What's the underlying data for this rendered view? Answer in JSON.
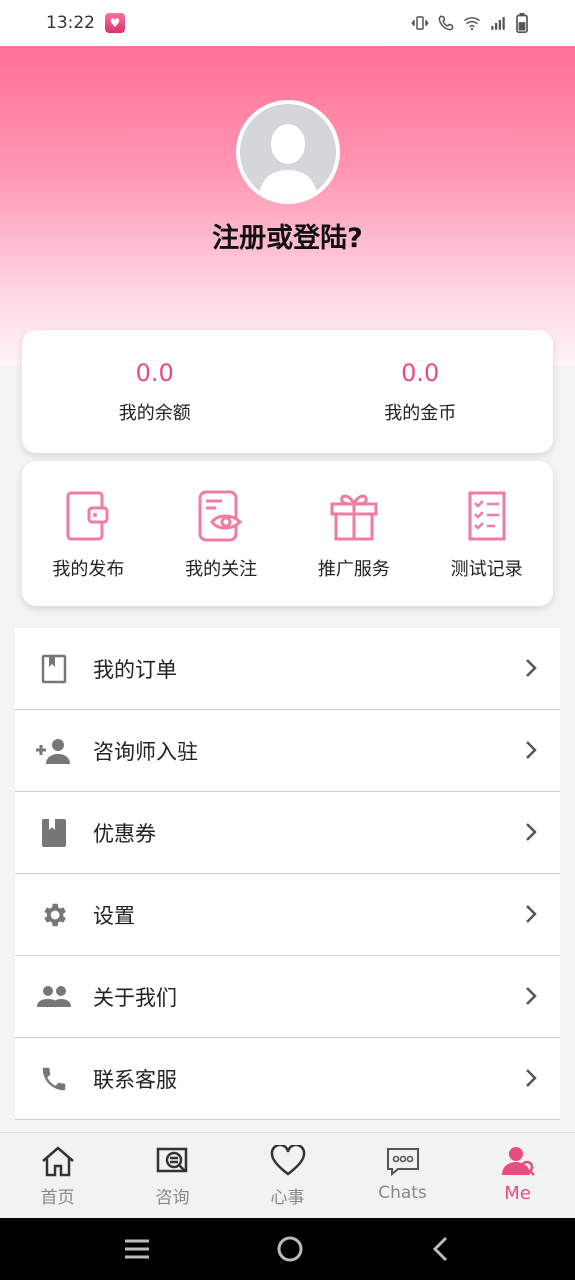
{
  "status_bar": {
    "time": "13:22"
  },
  "header": {
    "login_prompt": "注册或登陆?"
  },
  "balance": [
    {
      "value": "0.0",
      "label": "我的余额"
    },
    {
      "value": "0.0",
      "label": "我的金币"
    }
  ],
  "actions": [
    {
      "label": "我的发布",
      "icon": "wallet-icon"
    },
    {
      "label": "我的关注",
      "icon": "eye-card-icon"
    },
    {
      "label": "推广服务",
      "icon": "gift-icon"
    },
    {
      "label": "测试记录",
      "icon": "checklist-icon"
    }
  ],
  "menu": [
    {
      "label": "我的订单",
      "icon": "bookmark-book-icon"
    },
    {
      "label": "咨询师入驻",
      "icon": "add-person-icon"
    },
    {
      "label": "优惠券",
      "icon": "book-icon"
    },
    {
      "label": "设置",
      "icon": "gear-icon"
    },
    {
      "label": "关于我们",
      "icon": "people-icon"
    },
    {
      "label": "联系客服",
      "icon": "phone-icon"
    }
  ],
  "bottom_nav": [
    {
      "label": "首页",
      "icon": "home-icon"
    },
    {
      "label": "咨询",
      "icon": "consult-icon"
    },
    {
      "label": "心事",
      "icon": "heart-icon"
    },
    {
      "label": "Chats",
      "icon": "chat-icon"
    },
    {
      "label": "Me",
      "icon": "me-icon",
      "active": true
    }
  ],
  "colors": {
    "accent": "#e84c80",
    "header_top": "#ff7097"
  }
}
